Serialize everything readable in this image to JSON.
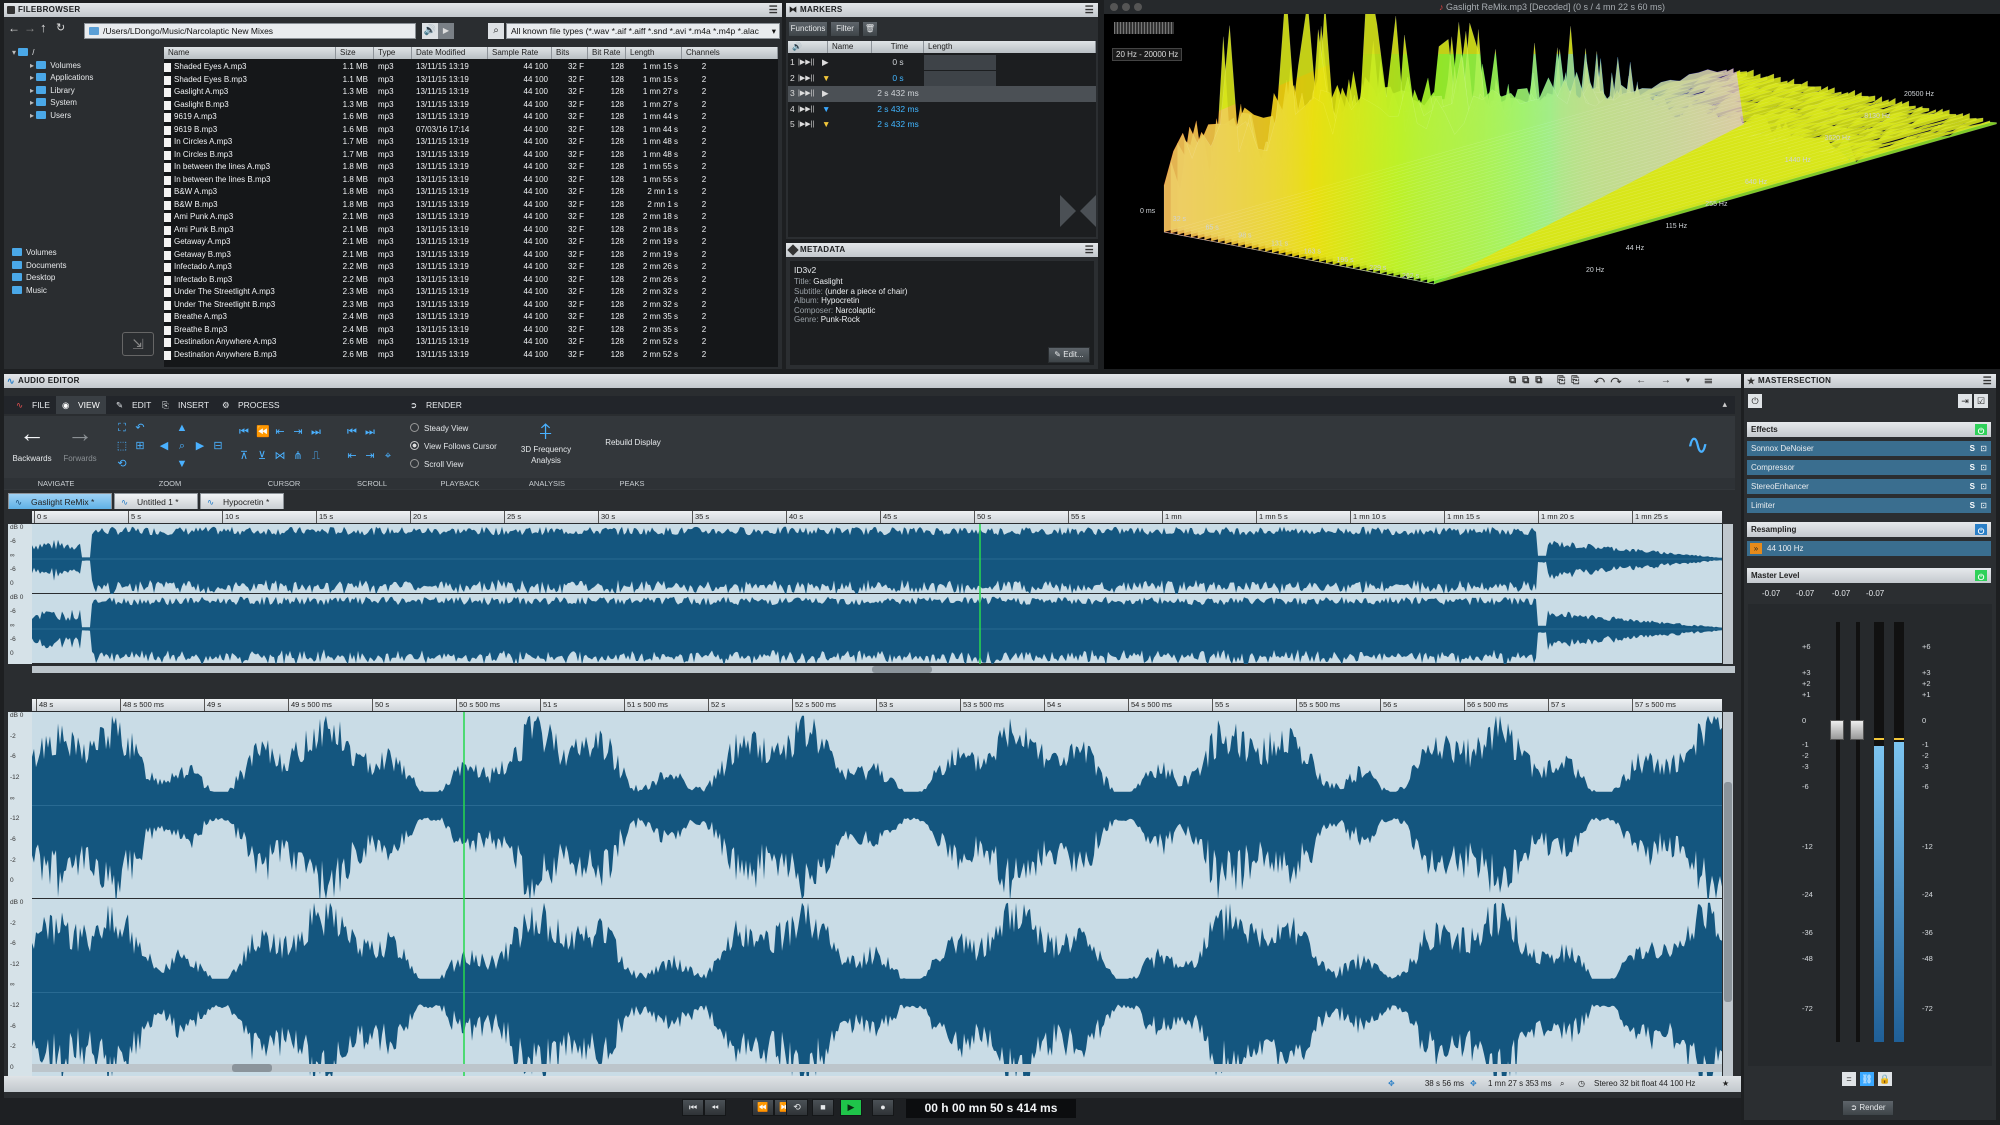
{
  "filebrowser": {
    "title": "FILEBROWSER",
    "path": "/Users/LDongo/Music/Narcolaptic New Mixes",
    "filter": "All known file types (*.wav *.aif *.aiff *.snd *.avi *.m4a *.m4p *.alac",
    "tree": [
      "/",
      "Volumes",
      "Applications",
      "Library",
      "System",
      "Users"
    ],
    "places": [
      "Volumes",
      "Documents",
      "Desktop",
      "Music"
    ],
    "columns": [
      "Name",
      "Size",
      "Type",
      "Date Modified",
      "Sample Rate",
      "Bits",
      "Bit Rate",
      "Length",
      "Channels"
    ],
    "rows": [
      [
        "Shaded Eyes A.mp3",
        "1.1 MB",
        "mp3",
        "13/11/15 13:19",
        "44 100",
        "32 F",
        "128",
        "1 mn 15 s",
        "2"
      ],
      [
        "Shaded Eyes B.mp3",
        "1.1 MB",
        "mp3",
        "13/11/15 13:19",
        "44 100",
        "32 F",
        "128",
        "1 mn 15 s",
        "2"
      ],
      [
        "Gaslight A.mp3",
        "1.3 MB",
        "mp3",
        "13/11/15 13:19",
        "44 100",
        "32 F",
        "128",
        "1 mn 27 s",
        "2"
      ],
      [
        "Gaslight B.mp3",
        "1.3 MB",
        "mp3",
        "13/11/15 13:19",
        "44 100",
        "32 F",
        "128",
        "1 mn 27 s",
        "2"
      ],
      [
        "9619 A.mp3",
        "1.6 MB",
        "mp3",
        "13/11/15 13:19",
        "44 100",
        "32 F",
        "128",
        "1 mn 44 s",
        "2"
      ],
      [
        "9619 B.mp3",
        "1.6 MB",
        "mp3",
        "07/03/16 17:14",
        "44 100",
        "32 F",
        "128",
        "1 mn 44 s",
        "2"
      ],
      [
        "In Circles A.mp3",
        "1.7 MB",
        "mp3",
        "13/11/15 13:19",
        "44 100",
        "32 F",
        "128",
        "1 mn 48 s",
        "2"
      ],
      [
        "In Circles B.mp3",
        "1.7 MB",
        "mp3",
        "13/11/15 13:19",
        "44 100",
        "32 F",
        "128",
        "1 mn 48 s",
        "2"
      ],
      [
        "In between the lines A.mp3",
        "1.8 MB",
        "mp3",
        "13/11/15 13:19",
        "44 100",
        "32 F",
        "128",
        "1 mn 55 s",
        "2"
      ],
      [
        "In between the lines B.mp3",
        "1.8 MB",
        "mp3",
        "13/11/15 13:19",
        "44 100",
        "32 F",
        "128",
        "1 mn 55 s",
        "2"
      ],
      [
        "B&W A.mp3",
        "1.8 MB",
        "mp3",
        "13/11/15 13:19",
        "44 100",
        "32 F",
        "128",
        "2 mn 1 s",
        "2"
      ],
      [
        "B&W B.mp3",
        "1.8 MB",
        "mp3",
        "13/11/15 13:19",
        "44 100",
        "32 F",
        "128",
        "2 mn 1 s",
        "2"
      ],
      [
        "Ami Punk A.mp3",
        "2.1 MB",
        "mp3",
        "13/11/15 13:19",
        "44 100",
        "32 F",
        "128",
        "2 mn 18 s",
        "2"
      ],
      [
        "Ami Punk B.mp3",
        "2.1 MB",
        "mp3",
        "13/11/15 13:19",
        "44 100",
        "32 F",
        "128",
        "2 mn 18 s",
        "2"
      ],
      [
        "Getaway A.mp3",
        "2.1 MB",
        "mp3",
        "13/11/15 13:19",
        "44 100",
        "32 F",
        "128",
        "2 mn 19 s",
        "2"
      ],
      [
        "Getaway B.mp3",
        "2.1 MB",
        "mp3",
        "13/11/15 13:19",
        "44 100",
        "32 F",
        "128",
        "2 mn 19 s",
        "2"
      ],
      [
        "Infectado A.mp3",
        "2.2 MB",
        "mp3",
        "13/11/15 13:19",
        "44 100",
        "32 F",
        "128",
        "2 mn 26 s",
        "2"
      ],
      [
        "Infectado B.mp3",
        "2.2 MB",
        "mp3",
        "13/11/15 13:19",
        "44 100",
        "32 F",
        "128",
        "2 mn 26 s",
        "2"
      ],
      [
        "Under The Streetlight A.mp3",
        "2.3 MB",
        "mp3",
        "13/11/15 13:19",
        "44 100",
        "32 F",
        "128",
        "2 mn 32 s",
        "2"
      ],
      [
        "Under The Streetlight B.mp3",
        "2.3 MB",
        "mp3",
        "13/11/15 13:19",
        "44 100",
        "32 F",
        "128",
        "2 mn 32 s",
        "2"
      ],
      [
        "Breathe A.mp3",
        "2.4 MB",
        "mp3",
        "13/11/15 13:19",
        "44 100",
        "32 F",
        "128",
        "2 mn 35 s",
        "2"
      ],
      [
        "Breathe B.mp3",
        "2.4 MB",
        "mp3",
        "13/11/15 13:19",
        "44 100",
        "32 F",
        "128",
        "2 mn 35 s",
        "2"
      ],
      [
        "Destination Anywhere A.mp3",
        "2.6 MB",
        "mp3",
        "13/11/15 13:19",
        "44 100",
        "32 F",
        "128",
        "2 mn 52 s",
        "2"
      ],
      [
        "Destination Anywhere B.mp3",
        "2.6 MB",
        "mp3",
        "13/11/15 13:19",
        "44 100",
        "32 F",
        "128",
        "2 mn 52 s",
        "2"
      ]
    ]
  },
  "markers": {
    "title": "MARKERS",
    "functions": "Functions",
    "filter": "Filter",
    "columns": [
      "Name",
      "Time",
      "Length"
    ],
    "rows": [
      {
        "num": "1",
        "time": "0 s",
        "color": "#cfd3d7",
        "icon": "play-marker-icon"
      },
      {
        "num": "2",
        "time": "0 s",
        "color": "#41b5ff",
        "icon": "yellow-marker-icon"
      },
      {
        "num": "3",
        "time": "2 s 432 ms",
        "color": "#cfd3d7",
        "icon": "play-marker-icon"
      },
      {
        "num": "4",
        "time": "2 s 432 ms",
        "color": "#41b5ff",
        "icon": "blue-marker-icon"
      },
      {
        "num": "5",
        "time": "2 s 432 ms",
        "color": "#41b5ff",
        "icon": "yellow-marker-icon"
      }
    ]
  },
  "metadata": {
    "title": "METADATA",
    "tag": "ID3v2",
    "fields": [
      {
        "label": "Title:",
        "value": "Gaslight"
      },
      {
        "label": "Subtitle:",
        "value": "(under a piece of chair)"
      },
      {
        "label": "Album:",
        "value": "Hypocretin"
      },
      {
        "label": "Composer:",
        "value": "Narcolaptic"
      },
      {
        "label": "Genre:",
        "value": "Punk-Rock"
      }
    ],
    "edit": "Edit..."
  },
  "analysis": {
    "title": "Gaslight ReMix.mp3 [Decoded] (0 s / 4 mn 22 s 60 ms)",
    "range": "20 Hz - 20000 Hz",
    "time_labels": [
      "0 ms",
      "32 s",
      "65 s",
      "98 s",
      "131 s",
      "163 s",
      "196 s",
      "229 s",
      "262 s"
    ],
    "freq_labels": [
      "20 Hz",
      "44 Hz",
      "115 Hz",
      "255 Hz",
      "640 Hz",
      "1440 Hz",
      "3620 Hz",
      "8130 Hz",
      "20500 Hz"
    ]
  },
  "editor": {
    "title": "AUDIO EDITOR",
    "tabs": [
      "FILE",
      "VIEW",
      "EDIT",
      "INSERT",
      "PROCESS",
      "RENDER"
    ],
    "navigate": {
      "back": "Backwards",
      "fwd": "Forwards"
    },
    "playback_options": [
      "Steady View",
      "View Follows Cursor",
      "Scroll View"
    ],
    "analysis_btn": "3D Frequency Analysis",
    "peaks_btn": "Rebuild Display",
    "groups": [
      "NAVIGATE",
      "ZOOM",
      "CURSOR",
      "SCROLL",
      "PLAYBACK",
      "ANALYSIS",
      "PEAKS"
    ],
    "file_tabs": [
      "Gaslight ReMix *",
      "Untitled 1 *",
      "Hypocretin *"
    ],
    "overview_ticks": [
      "0 s",
      "5 s",
      "10 s",
      "15 s",
      "20 s",
      "25 s",
      "30 s",
      "35 s",
      "40 s",
      "45 s",
      "50 s",
      "55 s",
      "1 mn",
      "1 mn 5 s",
      "1 mn 10 s",
      "1 mn 15 s",
      "1 mn 20 s",
      "1 mn 25 s"
    ],
    "main_ticks": [
      "48 s",
      "48 s 500 ms",
      "49 s",
      "49 s 500 ms",
      "50 s",
      "50 s 500 ms",
      "51 s",
      "51 s 500 ms",
      "52 s",
      "52 s 500 ms",
      "53 s",
      "53 s 500 ms",
      "54 s",
      "54 s 500 ms",
      "55 s",
      "55 s 500 ms",
      "56 s",
      "56 s 500 ms",
      "57 s",
      "57 s 500 ms"
    ],
    "db_labels_small": [
      "dB 0",
      "-6",
      "∞",
      "-6",
      "0"
    ],
    "db_labels_main": [
      "dB 0",
      "-2",
      "-6",
      "-12",
      "∞",
      "-12",
      "-6",
      "-2",
      "0"
    ],
    "status": {
      "zoom": "38 s 56 ms",
      "length": "1 mn 27 s 353 ms",
      "format": "Stereo 32 bit float 44 100 Hz"
    },
    "time_display": "00 h 00 mn 50 s 414 ms"
  },
  "master": {
    "title": "MASTERSECTION",
    "effects_label": "Effects",
    "effects": [
      "Sonnox DeNoiser",
      "Compressor",
      "StereoEnhancer",
      "Limiter"
    ],
    "resampling_label": "Resampling",
    "resample_value": "44 100 Hz",
    "master_label": "Master Level",
    "levels": [
      "-0.07",
      "-0.07",
      "-0.07",
      "-0.07"
    ],
    "scale": [
      "+6",
      "+3",
      "+2",
      "+1",
      "0",
      "-1",
      "-2",
      "-3",
      "-6",
      "-12",
      "-24",
      "-36",
      "-48",
      "-72"
    ],
    "render": "Render"
  },
  "colors": {
    "accent": "#3aa8ff",
    "wave": "#14567f",
    "wave_bg": "#c9dce6",
    "cursor": "#26d94d"
  }
}
